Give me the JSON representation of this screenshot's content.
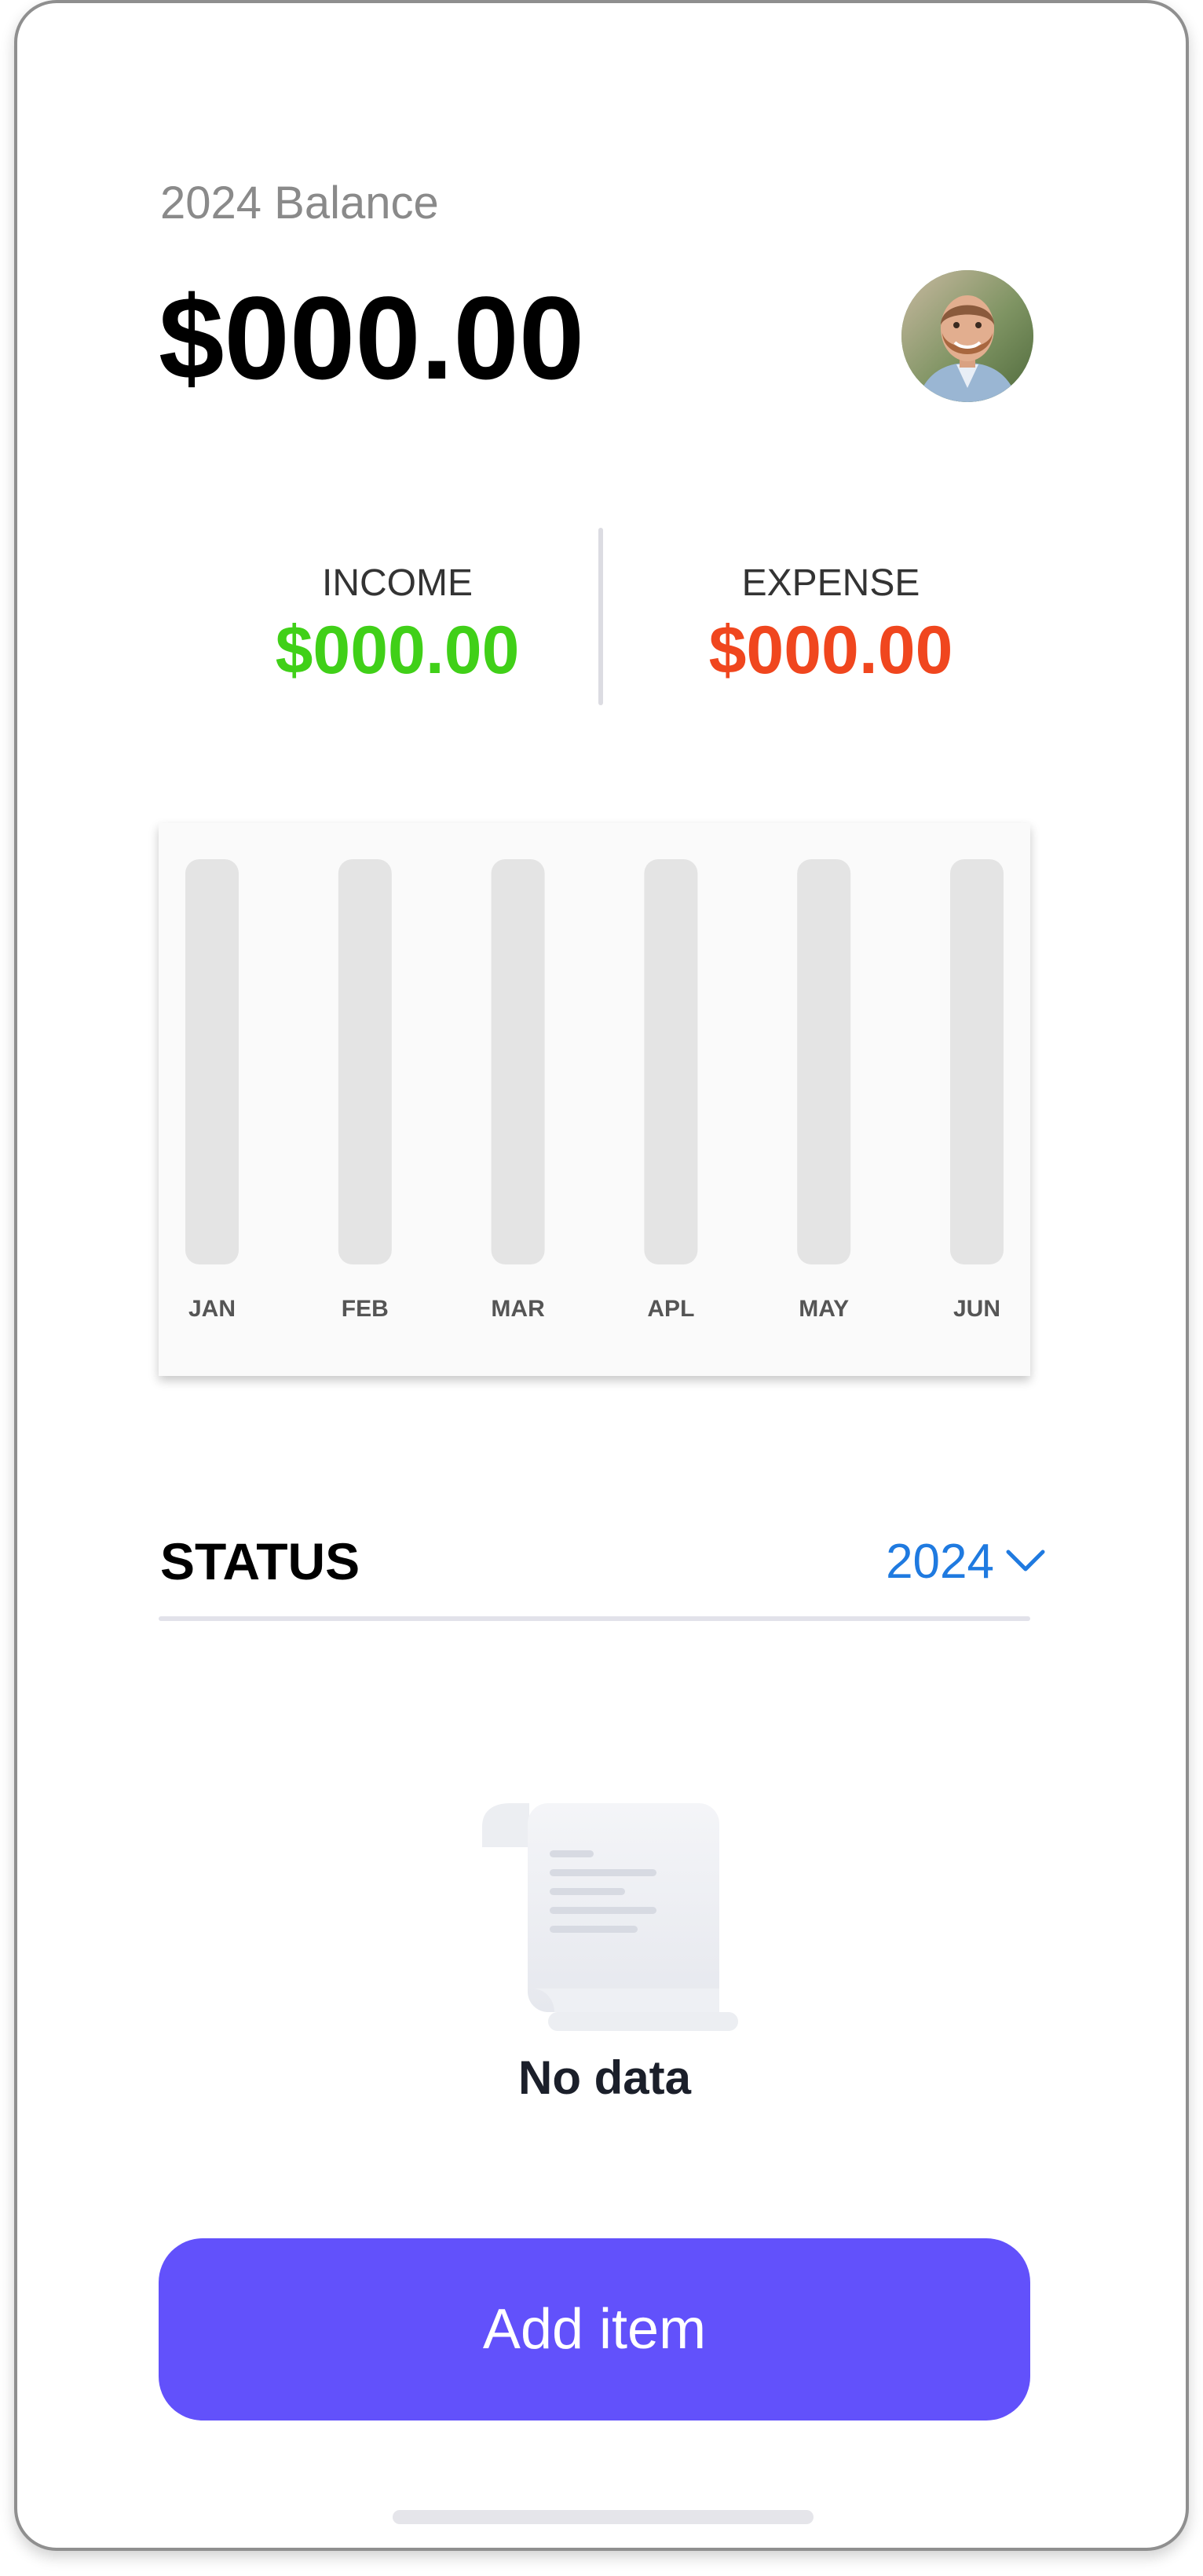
{
  "header": {
    "balance_label": "2024 Balance",
    "balance_value": "$000.00",
    "avatar_icon": "user-avatar-photo"
  },
  "summary": {
    "income_label": "INCOME",
    "income_value": "$000.00",
    "income_color": "#40d018",
    "expense_label": "EXPENSE",
    "expense_value": "$000.00",
    "expense_color": "#f0461e"
  },
  "chart_data": {
    "type": "bar",
    "categories": [
      "JAN",
      "FEB",
      "MAR",
      "APL",
      "MAY",
      "JUN"
    ],
    "series": [],
    "track_color": "#e4e4e4"
  },
  "status": {
    "title": "STATUS",
    "year_selected": "2024",
    "dropdown_icon": "chevron-down-icon",
    "accent_color": "#1f7ae0"
  },
  "empty_state": {
    "icon": "receipt-scroll-icon",
    "text": "No data"
  },
  "actions": {
    "add_item_label": "Add item",
    "button_color": "#6251fb"
  }
}
